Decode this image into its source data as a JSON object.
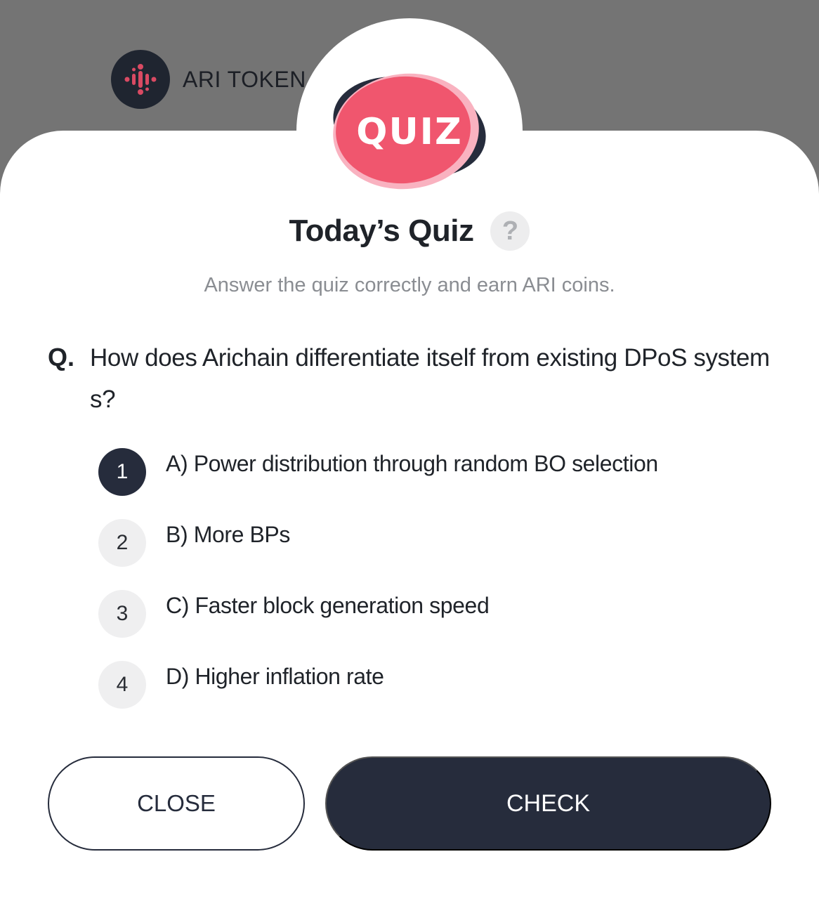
{
  "brand": {
    "name": "ARI TOKEN",
    "logo_icon": "ari-token-logo-icon"
  },
  "badge": {
    "text": "QUIZ",
    "colors": {
      "pink": "#f0566e",
      "light_pink": "#f9b2c0",
      "navy": "#262c3c"
    }
  },
  "header": {
    "title": "Today’s Quiz",
    "help_icon": "question-mark-icon",
    "help_glyph": "?",
    "subtitle": "Answer the quiz correctly and earn ARI coins."
  },
  "question": {
    "label": "Q.",
    "text": "How does Arichain differentiate itself from existing DPoS systems?"
  },
  "options": [
    {
      "number": "1",
      "text": "A) Power distribution through random BO selection",
      "selected": true
    },
    {
      "number": "2",
      "text": "B) More BPs",
      "selected": false
    },
    {
      "number": "3",
      "text": "C) Faster block generation speed",
      "selected": false
    },
    {
      "number": "4",
      "text": "D) Higher inflation rate",
      "selected": false
    }
  ],
  "actions": {
    "close_label": "CLOSE",
    "check_label": "CHECK"
  },
  "colors": {
    "primary": "#262c3c",
    "backdrop": "#747474",
    "muted_text": "#8a8d92",
    "option_bg": "#efeff0"
  }
}
